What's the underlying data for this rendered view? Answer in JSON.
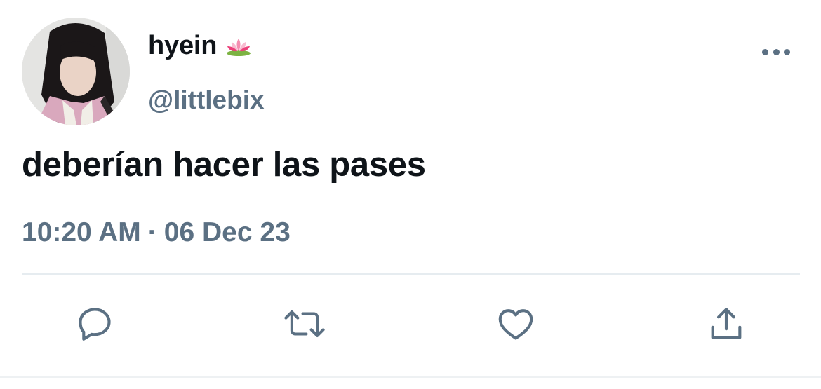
{
  "user": {
    "display_name": "hyein",
    "name_emoji": "lotus-emoji",
    "handle": "@littlebix",
    "avatar": "profile-photo"
  },
  "tweet": {
    "text": "deberían hacer las pases",
    "time": "10:20 AM",
    "separator": "·",
    "date": "06 Dec 23"
  },
  "actions": [
    {
      "name": "reply",
      "icon": "speech-bubble-icon"
    },
    {
      "name": "retweet",
      "icon": "retweet-arrows-icon"
    },
    {
      "name": "like",
      "icon": "heart-icon"
    },
    {
      "name": "share",
      "icon": "share-upload-icon"
    }
  ],
  "colors": {
    "text_primary": "#0f1419",
    "text_secondary": "#5b7083",
    "divider": "#e6ecf0"
  }
}
